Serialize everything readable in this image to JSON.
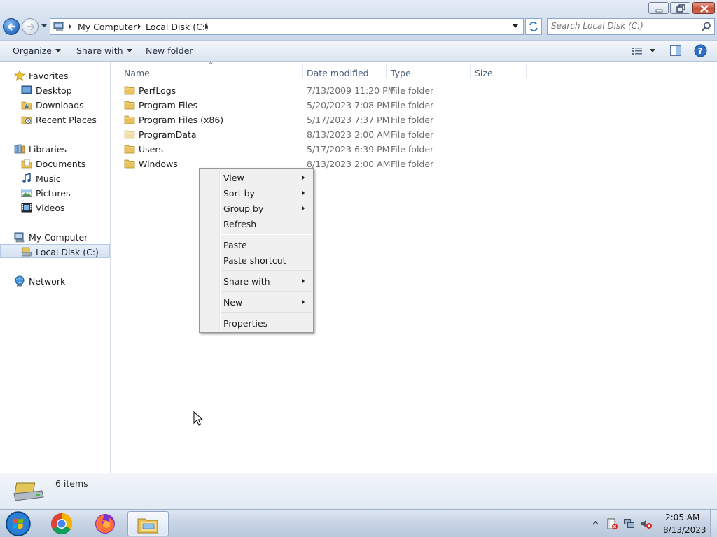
{
  "window": {
    "controls": {
      "minimize": "",
      "maximize": "",
      "close": ""
    }
  },
  "address": {
    "crumbs": [
      "My Computer",
      "Local Disk (C:)"
    ]
  },
  "search": {
    "placeholder": "Search Local Disk (C:)"
  },
  "command_bar": {
    "organize": "Organize",
    "share_with": "Share with",
    "new_folder": "New folder"
  },
  "nav": {
    "favorites": "Favorites",
    "desktop": "Desktop",
    "downloads": "Downloads",
    "recent_places": "Recent Places",
    "libraries": "Libraries",
    "documents": "Documents",
    "music": "Music",
    "pictures": "Pictures",
    "videos": "Videos",
    "my_computer": "My Computer",
    "local_disk": "Local Disk (C:)",
    "network": "Network"
  },
  "columns": {
    "name": "Name",
    "date_modified": "Date modified",
    "type": "Type",
    "size": "Size"
  },
  "files": [
    {
      "name": "PerfLogs",
      "date": "7/13/2009 11:20 PM",
      "type": "File folder"
    },
    {
      "name": "Program Files",
      "date": "5/20/2023 7:08 PM",
      "type": "File folder"
    },
    {
      "name": "Program Files (x86)",
      "date": "5/17/2023 7:37 PM",
      "type": "File folder"
    },
    {
      "name": "ProgramData",
      "date": "8/13/2023 2:00 AM",
      "type": "File folder"
    },
    {
      "name": "Users",
      "date": "5/17/2023 6:39 PM",
      "type": "File folder"
    },
    {
      "name": "Windows",
      "date": "8/13/2023 2:00 AM",
      "type": "File folder"
    }
  ],
  "context_menu": {
    "view": "View",
    "sort_by": "Sort by",
    "group_by": "Group by",
    "refresh": "Refresh",
    "paste": "Paste",
    "paste_shortcut": "Paste shortcut",
    "share_with": "Share with",
    "new": "New",
    "properties": "Properties"
  },
  "status": {
    "item_count": "6 items"
  },
  "taskbar": {
    "time": "2:05 AM",
    "date": "8/13/2023"
  },
  "colors": {
    "folder": "#e8c25a",
    "selection": "#d3e1f3",
    "taskbar": "#c8d5e6"
  }
}
